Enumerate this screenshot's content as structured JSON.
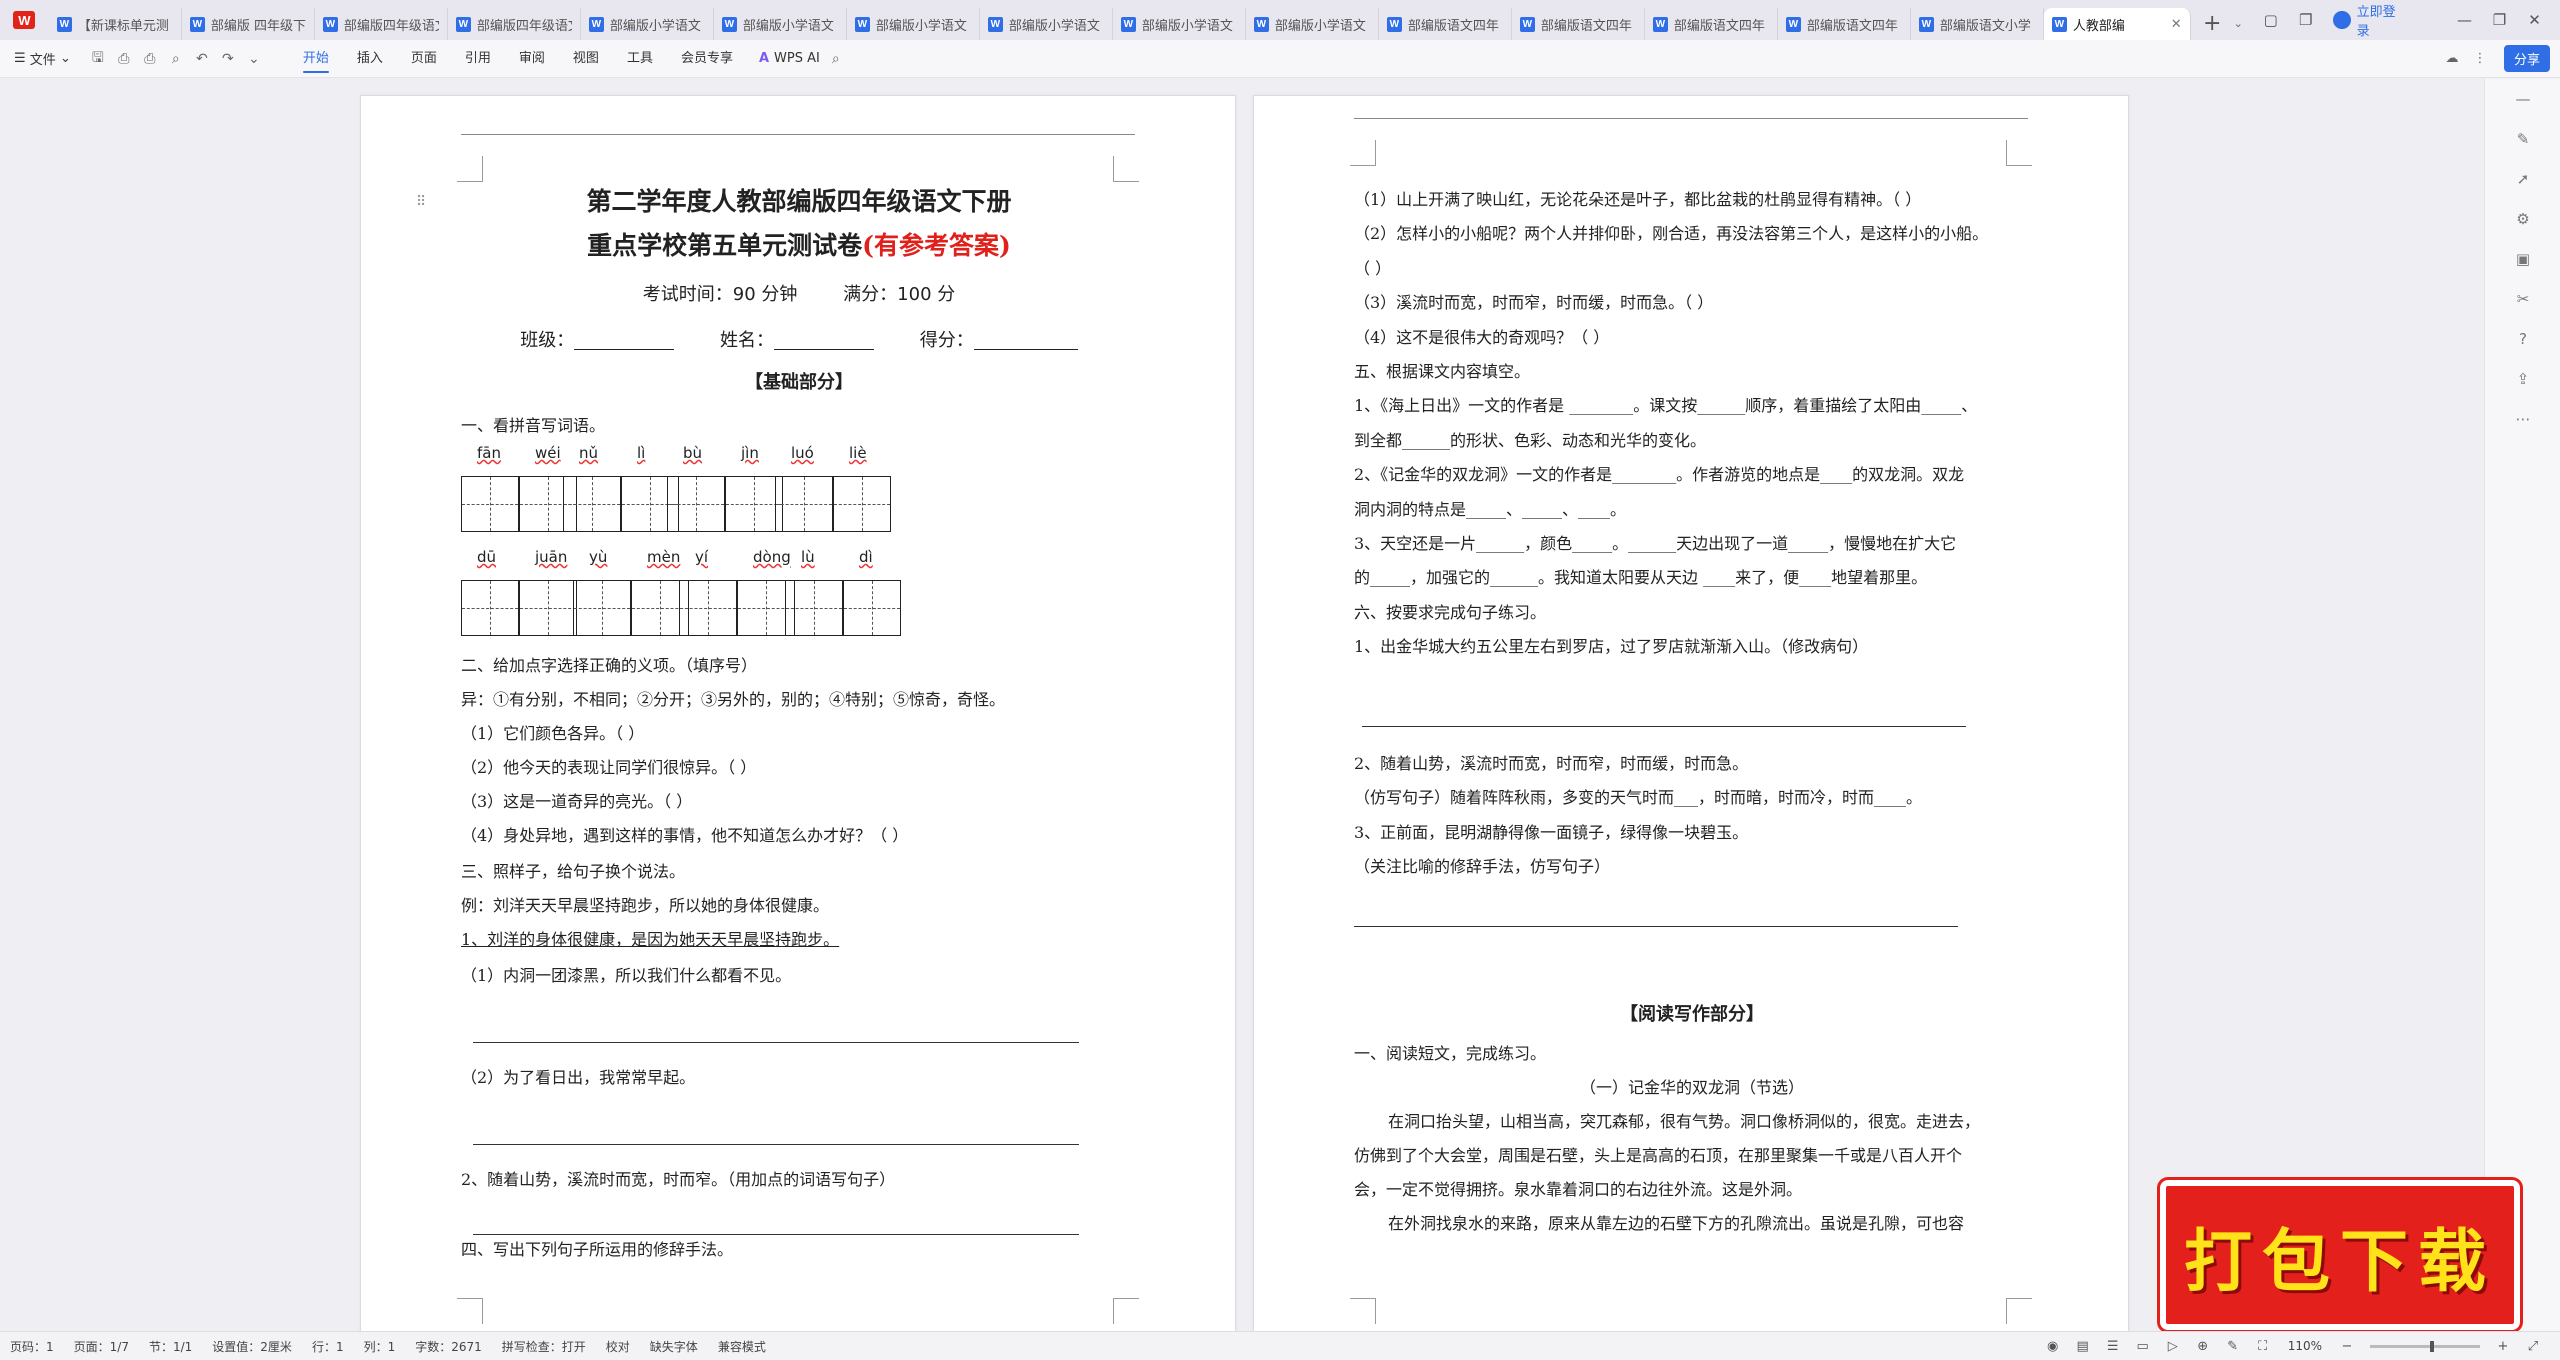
{
  "tabs": {
    "items": [
      "【新课标单元测",
      "部编版 四年级下",
      "部编版四年级语文",
      "部编版四年级语文",
      "部编版小学语文",
      "部编版小学语文",
      "部编版小学语文",
      "部编版小学语文",
      "部编版小学语文",
      "部编版小学语文",
      "部编版语文四年",
      "部编版语文四年",
      "部编版语文四年",
      "部编版语文四年",
      "部编版语文小学"
    ],
    "active": "人教部编",
    "login": "立即登录"
  },
  "ribbon": {
    "file": "文件",
    "menus": [
      "开始",
      "插入",
      "页面",
      "引用",
      "审阅",
      "视图",
      "工具",
      "会员专享"
    ],
    "active_menu": "开始",
    "wps_ai": "WPS AI",
    "share": "分享"
  },
  "page1": {
    "title1": "第二学年度人教部编版四年级语文下册",
    "title2": "重点学校第五单元测试卷",
    "title2_red": "(有参考答案)",
    "time": "考试时间：90 分钟",
    "score_full": "满分：100 分",
    "class_label": "班级：",
    "name_label": "姓名：",
    "score_label": "得分：",
    "section": "【基础部分】",
    "q1": "一、看拼音写词语。",
    "pinyin_row1": [
      "fān",
      "wéi",
      "nǔ",
      "lì",
      "bù",
      "jìn",
      "luó",
      "liè"
    ],
    "pinyin_row2": [
      "dū",
      "juān",
      "yù",
      "mèn",
      "yí",
      "dòng",
      "lù",
      "dì"
    ],
    "q2": "二、给加点字选择正确的义项。（填序号）",
    "q2_options": "异：①有分别，不相同；②分开；③另外的，别的；④特别；⑤惊奇，奇怪。",
    "q2_items": [
      "（1）它们颜色各异。（  ）",
      "（2）他今天的表现让同学们很惊异。（  ）",
      "（3）这是一道奇异的亮光。（  ）",
      "（4）身处异地，遇到这样的事情，他不知道怎么办才好？（  ）"
    ],
    "q3": "三、照样子，给句子换个说法。",
    "q3_example": "例：刘洋天天早晨坚持跑步，所以她的身体很健康。",
    "q3_answer": "1、刘洋的身体很健康，是因为她天天早晨坚持跑步。",
    "q3_item1": "（1）内洞一团漆黑，所以我们什么都看不见。",
    "q3_item2": "（2）为了看日出，我常常早起。",
    "q3_item3": "2、随着山势，溪流时而宽，时而窄。（用加点的词语写句子）",
    "q4": "四、写出下列句子所运用的修辞手法。"
  },
  "page2": {
    "lines": [
      "（1）山上开满了映山红，无论花朵还是叶子，都比盆栽的杜鹃显得有精神。（  ）",
      "（2）怎样小的小船呢？两个人并排仰卧，刚合适，再没法容第三个人，是这样小的小船。",
      "（  ）",
      "（3）溪流时而宽，时而窄，时而缓，时而急。（  ）",
      "（4）这不是很伟大的奇观吗？（  ）",
      "五、根据课文内容填空。",
      "1、《海上日出》一文的作者是 ________。课文按______顺序，着重描绘了太阳由_____、",
      "到全都______的形状、色彩、动态和光华的变化。",
      "2、《记金华的双龙洞》一文的作者是________。作者游览的地点是____的双龙洞。双龙",
      "洞内洞的特点是_____、_____、____。",
      "3、天空还是一片______，颜色_____。______天边出现了一道_____，慢慢地在扩大它",
      "的_____，加强它的______。我知道太阳要从天边 ____来了，便____地望着那里。",
      "六、按要求完成句子练习。",
      "1、出金华城大约五公里左右到罗店，过了罗店就渐渐入山。（修改病句）"
    ],
    "lines_b": [
      "2、随着山势，溪流时而宽，时而窄，时而缓，时而急。",
      "（仿写句子）随着阵阵秋雨，多变的天气时而___，时而暗，时而冷，时而____。",
      "3、正前面，昆明湖静得像一面镜子，绿得像一块碧玉。",
      "（关注比喻的修辞手法，仿写句子）"
    ],
    "section": "【阅读写作部分】",
    "read_q": "一、阅读短文，完成练习。",
    "read_title": "（一）记金华的双龙洞（节选）",
    "para": [
      "在洞口抬头望，山相当高，突兀森郁，很有气势。洞口像桥洞似的，很宽。走进去，",
      "仿佛到了个大会堂，周围是石壁，头上是高高的石顶，在那里聚集一千或是八百人开个",
      "会，一定不觉得拥挤。泉水靠着洞口的右边往外流。这是外洞。",
      "在外洞找泉水的来路，原来从靠左边的石壁下方的孔隙流出。虽说是孔隙，可也容"
    ]
  },
  "badge": "打包下载",
  "status": {
    "page_num": "页码：1",
    "page": "页面：1/7",
    "section": "节：1/1",
    "setting": "设置值：2厘米",
    "row": "行：1",
    "col": "列：1",
    "words": "字数：2671",
    "spell": "拼写检查：打开",
    "proof": "校对",
    "font_missing": "缺失字体",
    "compat": "兼容模式",
    "zoom": "110%"
  }
}
